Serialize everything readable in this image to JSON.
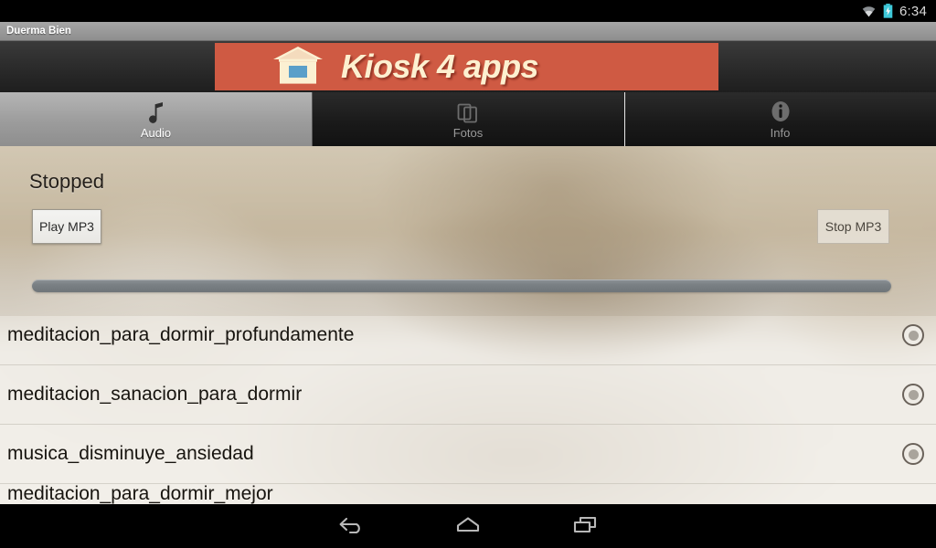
{
  "statusbar": {
    "time": "6:34",
    "icons": [
      "wifi-icon",
      "battery-charging-icon"
    ]
  },
  "titlebar": {
    "app_title": "Duerma Bien"
  },
  "ad_banner": {
    "text": "Kiosk 4 apps",
    "icon": "kiosk-gazebo-icon",
    "background_color": "#cf5a43",
    "text_color": "#fdf0d0"
  },
  "tabs": [
    {
      "label": "Audio",
      "icon": "music-note-icon",
      "active": true
    },
    {
      "label": "Fotos",
      "icon": "gallery-photos-icon",
      "active": false
    },
    {
      "label": "Info",
      "icon": "info-circle-icon",
      "active": false
    }
  ],
  "player": {
    "status": "Stopped",
    "play_label": "Play MP3",
    "stop_label": "Stop MP3",
    "seek_position": 0
  },
  "track_list": [
    {
      "name": "meditacion_para_dormir_profundamente",
      "selected": false
    },
    {
      "name": "meditacion_sanacion_para_dormir",
      "selected": false
    },
    {
      "name": "musica_disminuye_ansiedad",
      "selected": false
    },
    {
      "name": "meditacion_para_dormir_mejor",
      "selected": false
    }
  ],
  "navbar": {
    "back": "back-icon",
    "home": "home-icon",
    "recents": "recents-icon"
  }
}
